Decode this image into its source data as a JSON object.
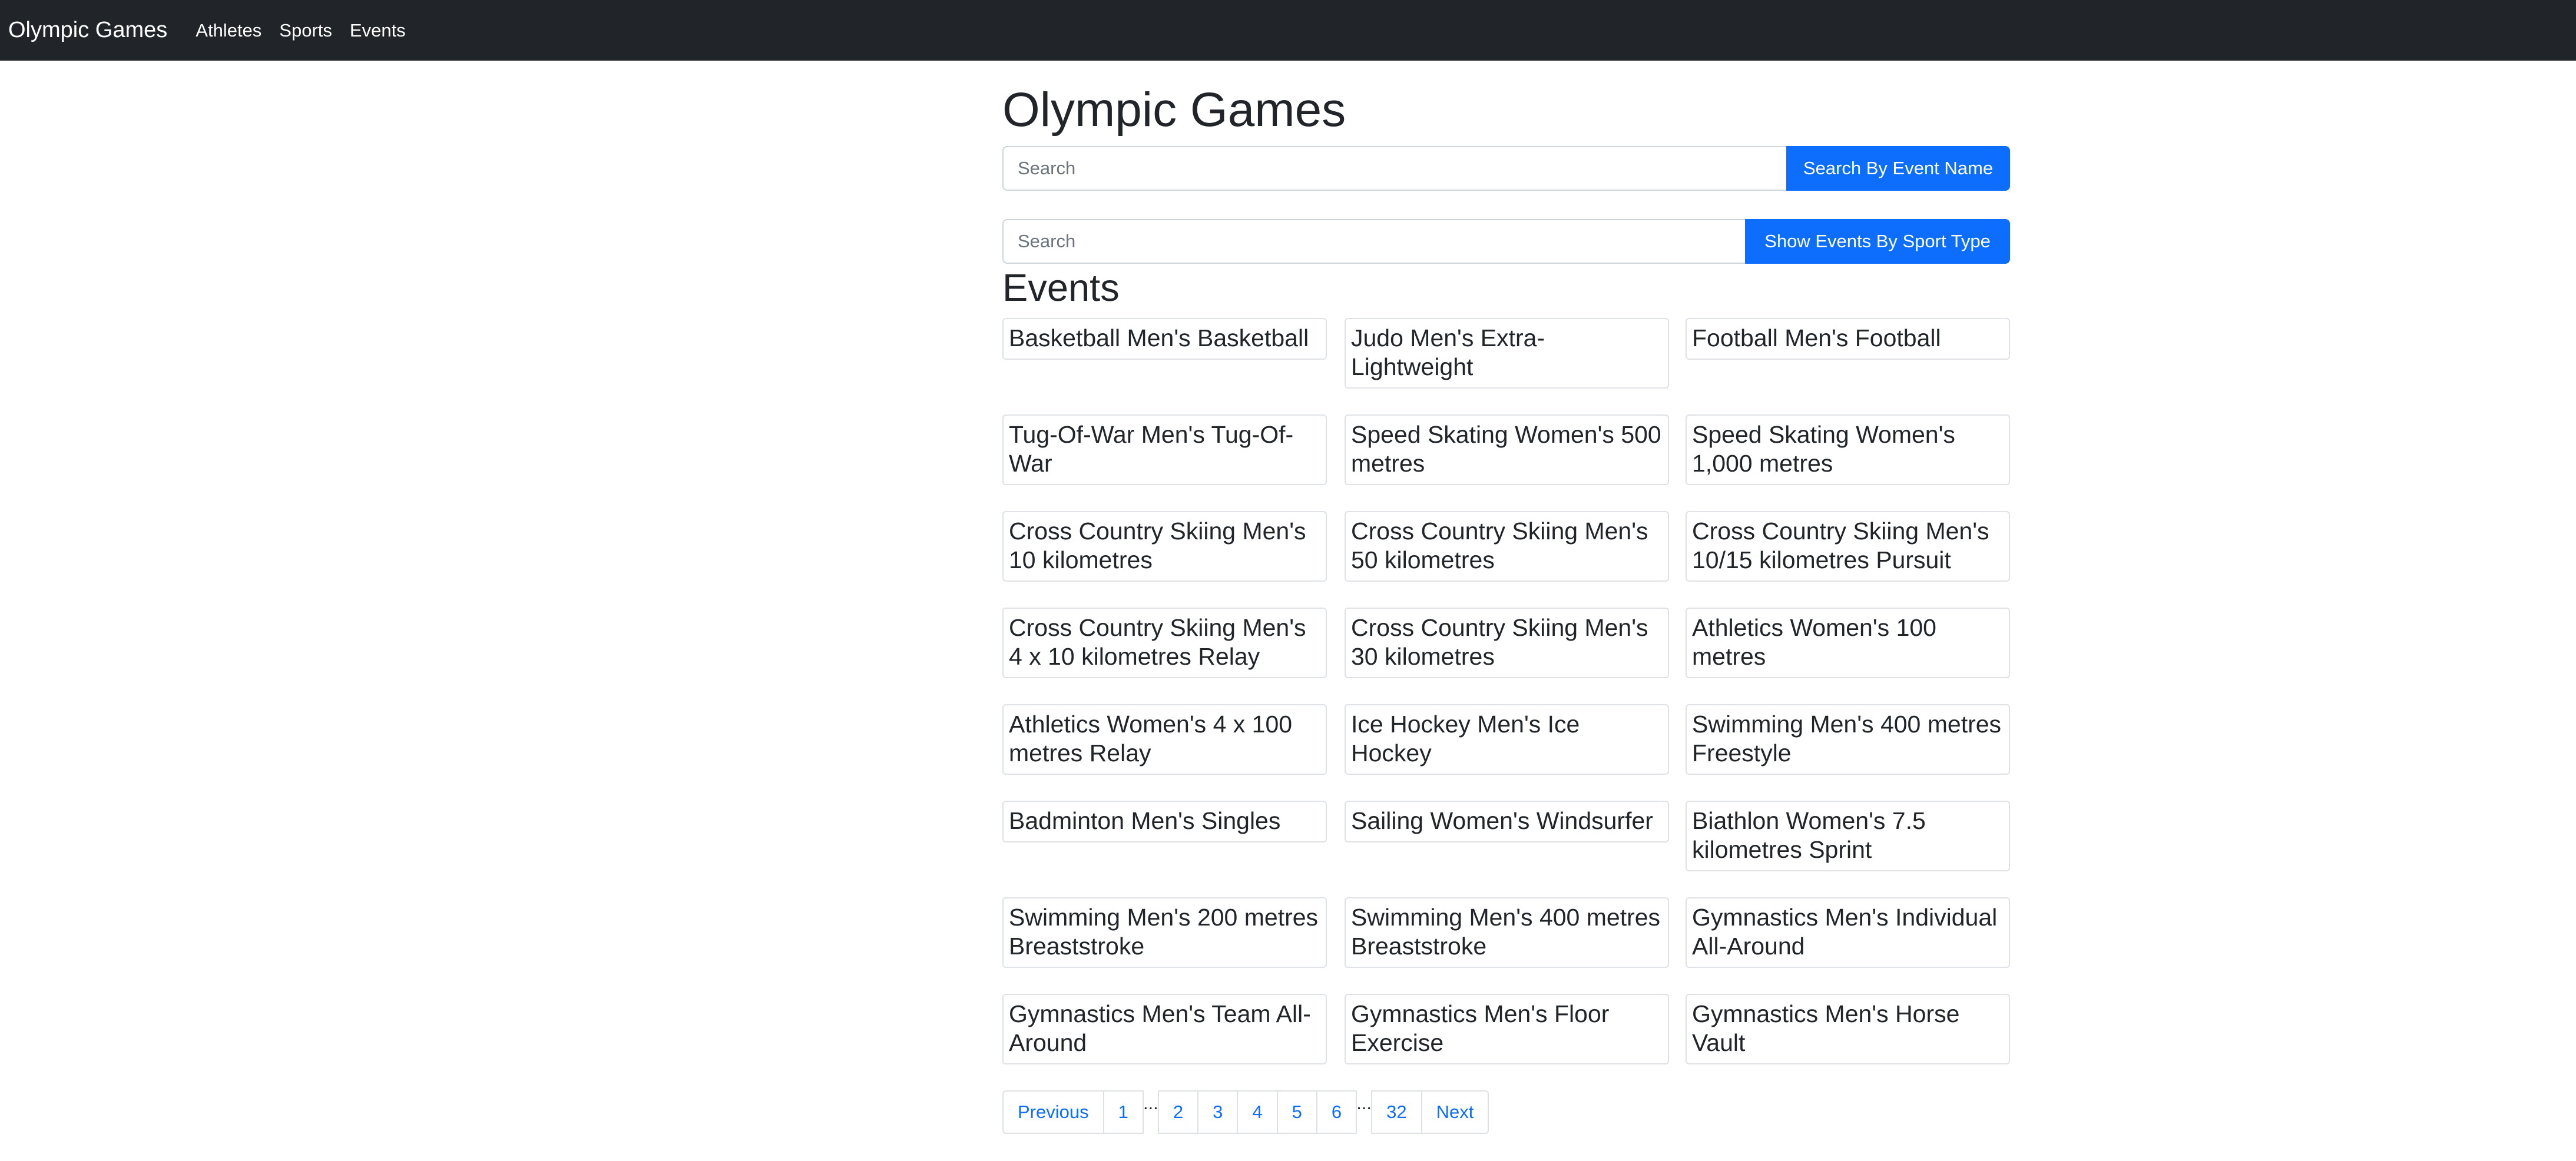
{
  "navbar": {
    "brand": "Olympic Games",
    "links": [
      "Athletes",
      "Sports",
      "Events"
    ]
  },
  "page": {
    "title": "Olympic Games",
    "section_title": "Events"
  },
  "search_event": {
    "placeholder": "Search",
    "value": "",
    "button_label": "Search By Event Name"
  },
  "search_sport": {
    "placeholder": "Search",
    "value": "",
    "button_label": "Show Events By Sport Type"
  },
  "events": [
    "Basketball Men's Basketball",
    "Judo Men's Extra-Lightweight",
    "Football Men's Football",
    "Tug-Of-War Men's Tug-Of-War",
    "Speed Skating Women's 500 metres",
    "Speed Skating Women's 1,000 metres",
    "Cross Country Skiing Men's 10 kilometres",
    "Cross Country Skiing Men's 50 kilometres",
    "Cross Country Skiing Men's 10/15 kilometres Pursuit",
    "Cross Country Skiing Men's 4 x 10 kilometres Relay",
    "Cross Country Skiing Men's 30 kilometres",
    "Athletics Women's 100 metres",
    "Athletics Women's 4 x 100 metres Relay",
    "Ice Hockey Men's Ice Hockey",
    "Swimming Men's 400 metres Freestyle",
    "Badminton Men's Singles",
    "Sailing Women's Windsurfer",
    "Biathlon Women's 7.5 kilometres Sprint",
    "Swimming Men's 200 metres Breaststroke",
    "Swimming Men's 400 metres Breaststroke",
    "Gymnastics Men's Individual All-Around",
    "Gymnastics Men's Team All-Around",
    "Gymnastics Men's Floor Exercise",
    "Gymnastics Men's Horse Vault"
  ],
  "pagination": {
    "previous": "Previous",
    "next": "Next",
    "ellipsis": "...",
    "first_page": "1",
    "middle_pages": [
      "2",
      "3",
      "4",
      "5",
      "6"
    ],
    "last_page": "32"
  },
  "colors": {
    "navbar_bg": "#212529",
    "primary": "#0d6efd",
    "border": "#dee2e6",
    "text": "#212529"
  }
}
